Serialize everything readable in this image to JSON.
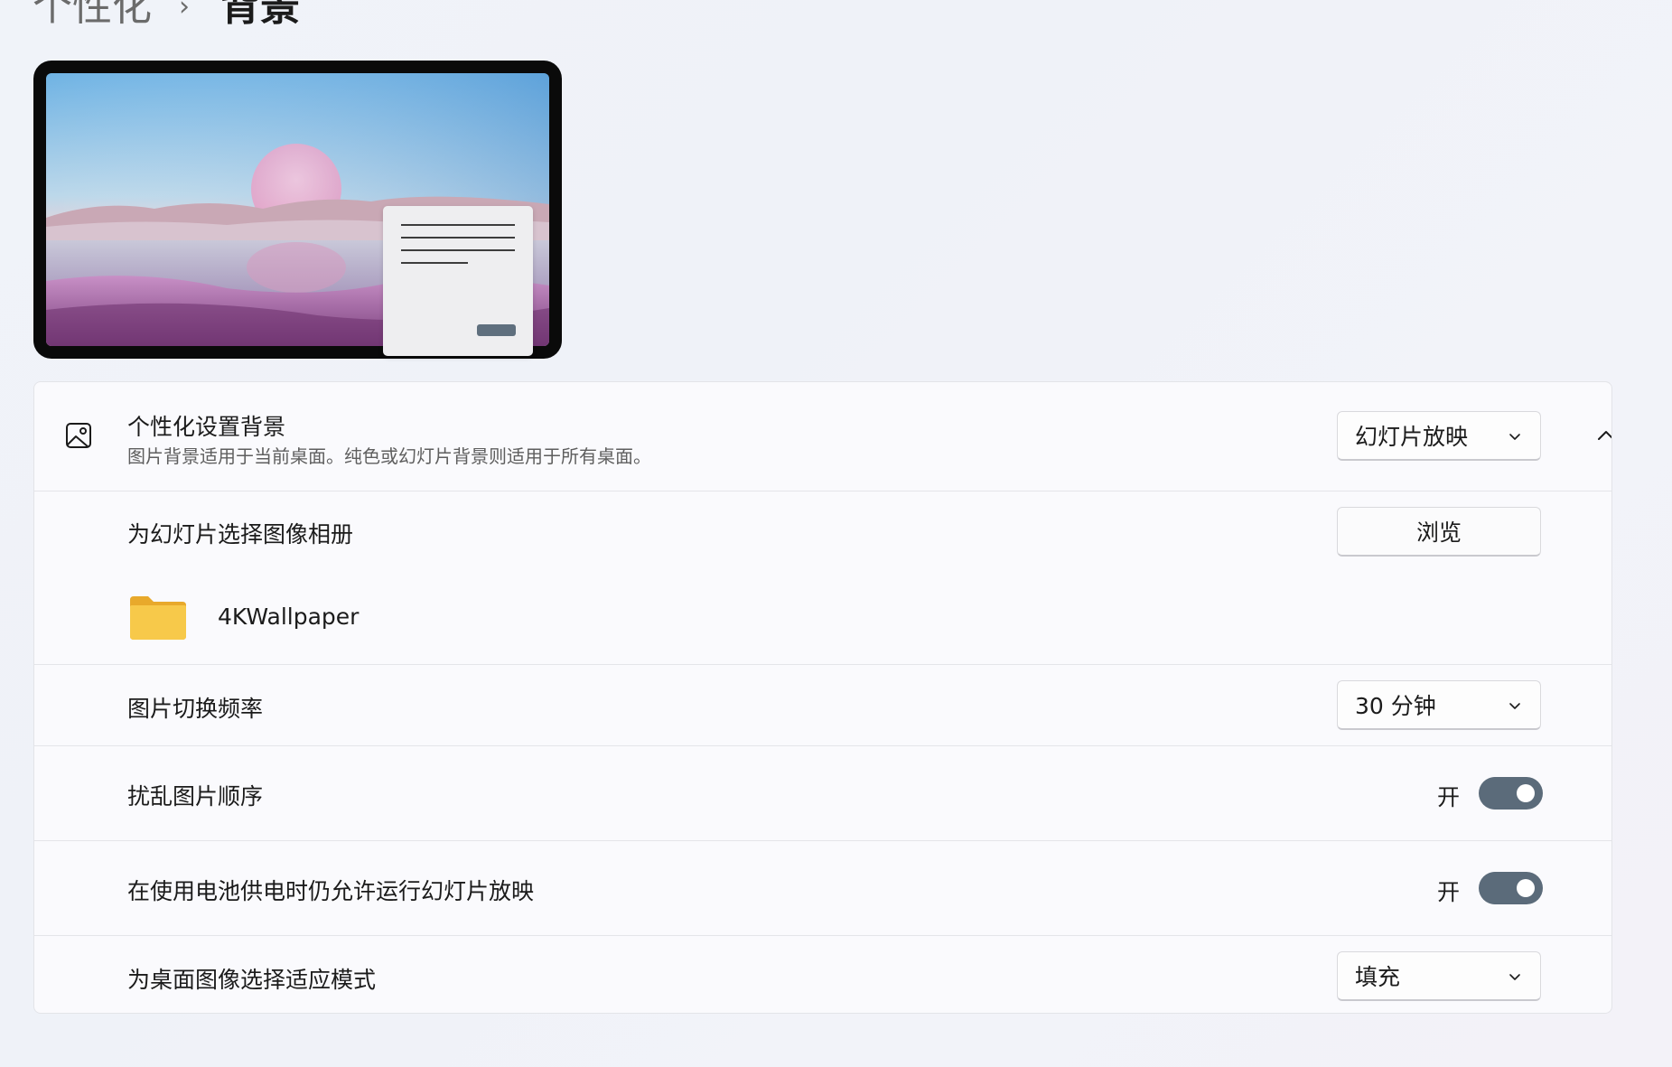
{
  "breadcrumb": {
    "parent": "个性化",
    "separator": "›",
    "current": "背景"
  },
  "personalize": {
    "icon": "image-icon",
    "title": "个性化设置背景",
    "description": "图片背景适用于当前桌面。纯色或幻灯片背景则适用于所有桌面。",
    "selected": "幻灯片放映",
    "expanded": true
  },
  "album": {
    "label": "为幻灯片选择图像相册",
    "browse_label": "浏览",
    "folder_icon": "folder-icon",
    "folder_name": "4KWallpaper"
  },
  "frequency": {
    "label": "图片切换频率",
    "selected": "30 分钟"
  },
  "shuffle": {
    "label": "扰乱图片顺序",
    "state_label": "开",
    "on": true
  },
  "battery": {
    "label": "在使用电池供电时仍允许运行幻灯片放映",
    "state_label": "开",
    "on": true
  },
  "fit": {
    "label": "为桌面图像选择适应模式",
    "selected": "填充"
  },
  "colors": {
    "toggle_on": "#5b6b7a",
    "folder": "#f7c94a"
  }
}
